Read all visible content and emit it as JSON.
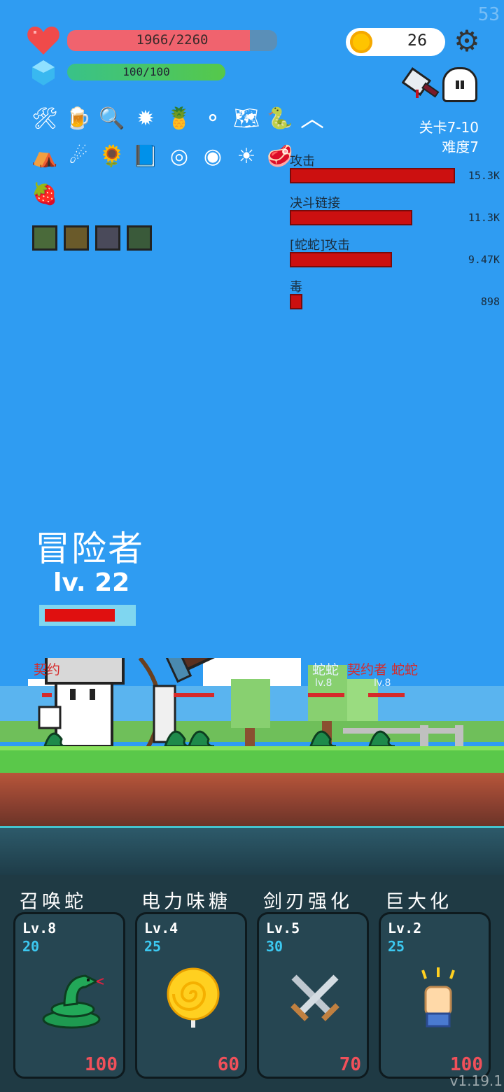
{
  "hud": {
    "fps": "53",
    "hp_text": "1966/2260",
    "hp_fraction": 0.87,
    "mp_text": "100/100",
    "mp_fraction": 1.0,
    "coins": "26",
    "stage": "关卡7-10",
    "difficulty": "难度7"
  },
  "damage_stats": [
    {
      "label": "攻击",
      "value": "15.3K",
      "fraction": 1.0
    },
    {
      "label": "决斗链接",
      "value": "11.3K",
      "fraction": 0.74
    },
    {
      "label": "[蛇蛇]攻击",
      "value": "9.47K",
      "fraction": 0.62
    },
    {
      "label": "毒",
      "value": "898",
      "fraction": 0.06
    }
  ],
  "adventurer": {
    "name": "冒险者",
    "level": "lv. 22",
    "hp_fraction": 0.82
  },
  "enemies": {
    "left_label": "契约",
    "mid_label": "蛇蛇",
    "right_label": "契约者 蛇蛇",
    "lv_mid": "lv.8",
    "lv_right": "lv.8"
  },
  "cards": [
    {
      "title": "召唤蛇",
      "level": "Lv.8",
      "cost": "20",
      "price": "100",
      "icon": "snake-icon"
    },
    {
      "title": "电力味糖",
      "level": "Lv.4",
      "cost": "25",
      "price": "60",
      "icon": "lollipop-icon"
    },
    {
      "title": "剑刃强化",
      "level": "Lv.5",
      "cost": "30",
      "price": "70",
      "icon": "crossed-swords-icon"
    },
    {
      "title": "巨大化",
      "level": "Lv.2",
      "cost": "25",
      "price": "100",
      "icon": "fist-icon"
    }
  ],
  "version": "v1.19.1",
  "colors": {
    "sky": "#2f9cf2",
    "hp": "#f0636e",
    "damage_bar": "#cc1010",
    "card_price": "#f0505a",
    "card_cost": "#3cc8f0"
  }
}
